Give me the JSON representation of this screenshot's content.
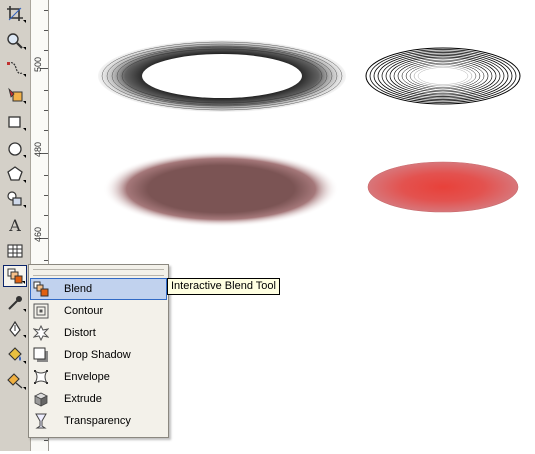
{
  "ruler": {
    "labels": [
      "500",
      "480",
      "460"
    ]
  },
  "toolbox": {
    "tools": [
      {
        "name": "crop-tool",
        "icon": "crop-icon"
      },
      {
        "name": "zoom-tool",
        "icon": "magnifier-icon"
      },
      {
        "name": "freehand-tool",
        "icon": "curve-icon"
      },
      {
        "name": "smart-fill-tool",
        "icon": "smart-fill-icon"
      },
      {
        "name": "rectangle-tool",
        "icon": "rectangle-icon"
      },
      {
        "name": "ellipse-tool",
        "icon": "ellipse-icon"
      },
      {
        "name": "polygon-tool",
        "icon": "polygon-icon"
      },
      {
        "name": "basic-shapes-tool",
        "icon": "shapes-icon"
      },
      {
        "name": "text-tool",
        "label": "A",
        "icon": "text-icon"
      },
      {
        "name": "table-tool",
        "icon": "table-icon"
      },
      {
        "name": "interactive-blend-tool",
        "icon": "blend-icon",
        "active": true
      },
      {
        "name": "eyedropper-tool",
        "icon": "eyedropper-icon"
      },
      {
        "name": "outline-tool",
        "icon": "pen-nib-icon"
      },
      {
        "name": "fill-tool",
        "icon": "paint-bucket-icon"
      },
      {
        "name": "interactive-fill-tool",
        "icon": "interactive-fill-icon"
      }
    ]
  },
  "flyout": {
    "items": [
      {
        "label": "Blend",
        "icon": "blend-icon",
        "selected": true
      },
      {
        "label": "Contour",
        "icon": "contour-icon"
      },
      {
        "label": "Distort",
        "icon": "distort-icon"
      },
      {
        "label": "Drop Shadow",
        "icon": "drop-shadow-icon"
      },
      {
        "label": "Envelope",
        "icon": "envelope-icon"
      },
      {
        "label": "Extrude",
        "icon": "extrude-icon"
      },
      {
        "label": "Transparency",
        "icon": "transparency-icon"
      }
    ]
  },
  "tooltip": {
    "text": "Interactive Blend Tool"
  },
  "colors": {
    "toolbox_bg": "#d4d0c8",
    "menu_bg": "#f3f1ea",
    "selection_bg": "#c1d2ee",
    "selection_border": "#316ac5",
    "shadow_brown": "#7b5454",
    "red_glow": "#e8413a",
    "red_outer": "#d8767a"
  }
}
